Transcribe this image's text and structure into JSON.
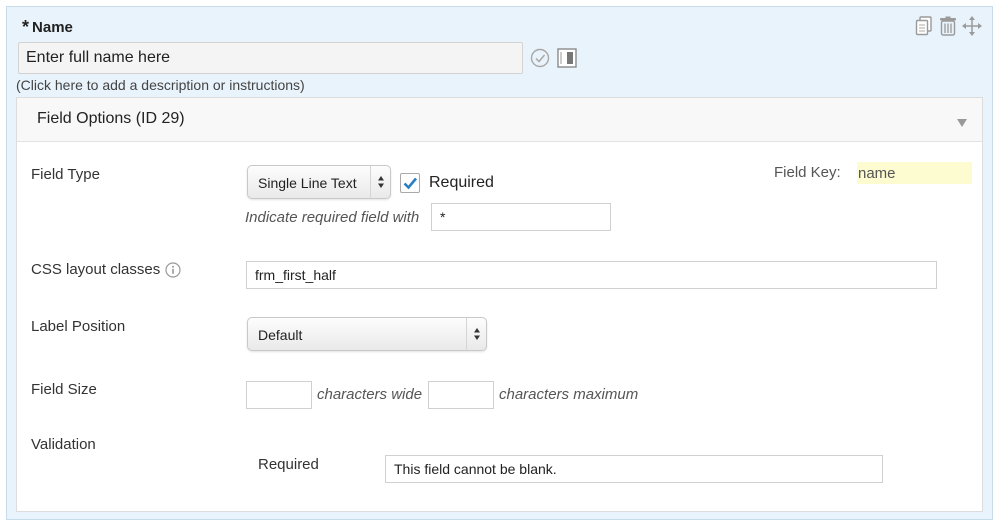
{
  "field": {
    "required_marker": "*",
    "label": "Name",
    "default_value": "Enter full name here",
    "description_prompt": "(Click here to add a description or instructions)"
  },
  "icons": {
    "duplicate": "duplicate-icon",
    "delete": "trash-icon",
    "move": "move-icon",
    "default_value_check": "check-circle-icon",
    "clear_on_focus": "column-icon",
    "collapse": "triangle-down-icon",
    "info": "info-icon"
  },
  "options": {
    "title": "Field Options (ID 29)",
    "field_type": {
      "label": "Field Type",
      "selected": "Single Line Text",
      "required_checked": true,
      "required_label": "Required",
      "indicate_label": "Indicate required field with",
      "indicate_value": "*"
    },
    "field_key": {
      "label": "Field Key:",
      "value": "name"
    },
    "css_classes": {
      "label": "CSS layout classes",
      "value": "frm_first_half"
    },
    "label_position": {
      "label": "Label Position",
      "selected": "Default"
    },
    "field_size": {
      "label": "Field Size",
      "width_value": "",
      "width_suffix": "characters wide",
      "max_value": "",
      "max_suffix": "characters maximum"
    },
    "validation": {
      "label": "Validation",
      "required_label": "Required",
      "required_message": "This field cannot be blank."
    }
  },
  "colors": {
    "card_bg": "#e9f3fb",
    "field_key_highlight": "#fdfbd0",
    "checkmark": "#2b7fc1"
  }
}
